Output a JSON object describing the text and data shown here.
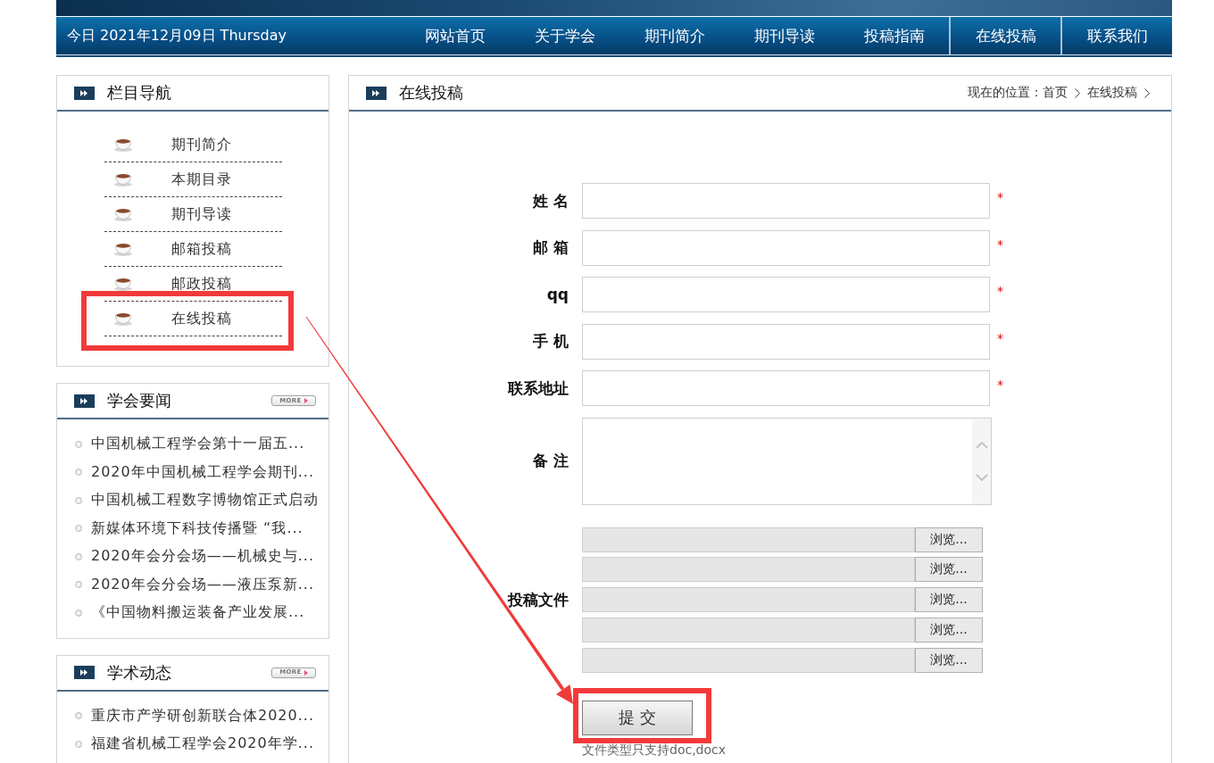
{
  "header": {
    "date": "今日 2021年12月09日 Thursday",
    "nav": [
      {
        "label": "网站首页",
        "selected": false
      },
      {
        "label": "关于学会",
        "selected": false
      },
      {
        "label": "期刊简介",
        "selected": false
      },
      {
        "label": "期刊导读",
        "selected": false
      },
      {
        "label": "投稿指南",
        "selected": false
      },
      {
        "label": "在线投稿",
        "selected": true
      },
      {
        "label": "联系我们",
        "selected": false
      }
    ]
  },
  "sidebar": {
    "panels": [
      {
        "title": "栏目导航",
        "kind": "menu",
        "items": [
          {
            "label": "期刊简介",
            "highlighted": false
          },
          {
            "label": "本期目录",
            "highlighted": false
          },
          {
            "label": "期刊导读",
            "highlighted": false
          },
          {
            "label": "邮箱投稿",
            "highlighted": false
          },
          {
            "label": "邮政投稿",
            "highlighted": false
          },
          {
            "label": "在线投稿",
            "highlighted": true
          }
        ]
      },
      {
        "title": "学会要闻",
        "kind": "news",
        "more": "MORE",
        "items": [
          "中国机械工程学会第十一届五...",
          "2020年中国机械工程学会期刊...",
          "中国机械工程数字博物馆正式启动",
          "新媒体环境下科技传播暨 “我...",
          "2020年会分会场——机械史与...",
          "2020年会分会场——液压泵新...",
          "《中国物料搬运装备产业发展..."
        ]
      },
      {
        "title": "学术动态",
        "kind": "news",
        "more": "MORE",
        "items": [
          "重庆市产学研创新联合体2020...",
          "福建省机械工程学会2020年学..."
        ]
      }
    ]
  },
  "main": {
    "title": "在线投稿",
    "breadcrumb": {
      "label": "现在的位置：",
      "items": [
        "首页",
        "在线投稿"
      ]
    },
    "form": {
      "fields": [
        {
          "label": "姓 名",
          "kind": "text",
          "required_mark": "*"
        },
        {
          "label": "邮 箱",
          "kind": "text",
          "required_mark": "*"
        },
        {
          "label": "qq",
          "kind": "text",
          "required_mark": "*"
        },
        {
          "label": "手 机",
          "kind": "text",
          "required_mark": "*"
        },
        {
          "label": "联系地址",
          "kind": "text",
          "required_mark": "*"
        },
        {
          "label": "备 注",
          "kind": "textarea"
        }
      ],
      "files": {
        "label": "投稿文件",
        "inputs": [
          {
            "button": "浏览..."
          },
          {
            "button": "浏览..."
          },
          {
            "button": "浏览..."
          },
          {
            "button": "浏览..."
          },
          {
            "button": "浏览..."
          }
        ]
      },
      "submit": {
        "label": "提 交",
        "highlighted": true
      },
      "note": "文件类型只支持doc,docx"
    }
  },
  "annotation_arrow": true
}
